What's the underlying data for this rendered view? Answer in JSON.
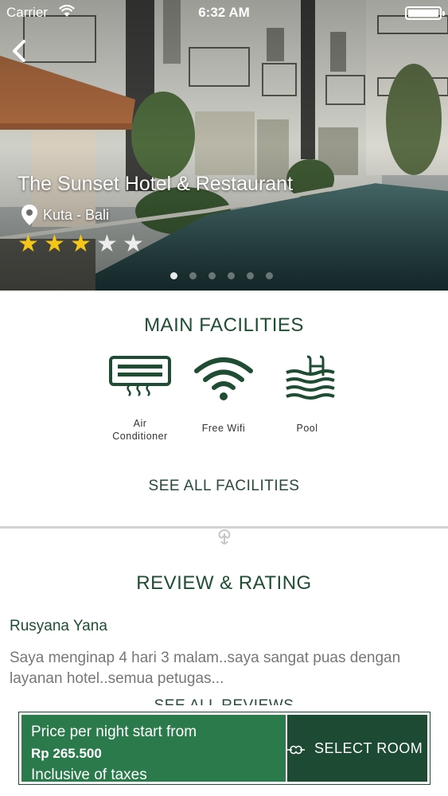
{
  "status_bar": {
    "carrier": "Carrier",
    "time": "6:32 AM",
    "battery": "full"
  },
  "hero": {
    "hotel_name": "The Sunset Hotel & Restaurant",
    "location": "Kuta - Bali",
    "rating": 3,
    "max_rating": 5,
    "carousel_pages": 6,
    "carousel_active_index": 0
  },
  "facilities": {
    "title": "MAIN FACILITIES",
    "items": [
      {
        "icon": "air-conditioner-icon",
        "label_line1": "Air",
        "label_line2": "Conditioner"
      },
      {
        "icon": "wifi-icon",
        "label_line1": "Free Wifi",
        "label_line2": ""
      },
      {
        "icon": "pool-icon",
        "label_line1": "Pool",
        "label_line2": ""
      }
    ],
    "see_all": "SEE ALL FACILITIES"
  },
  "reviews": {
    "title": "REVIEW & RATING",
    "reviewer": "Rusyana Yana",
    "text": "Saya menginap 4 hari 3 malam..saya sangat puas dengan layanan hotel..semua petugas...",
    "see_all": "SEE ALL REVIEWS"
  },
  "booking": {
    "price_line1": "Price per night start from",
    "price_amount": "Rp 265.500",
    "price_line3": "Inclusive of taxes",
    "select_label": "SELECT ROOM"
  },
  "colors": {
    "dark_green": "#1d4a32",
    "price_green": "#2b7a4c",
    "title_green": "#1f4d33",
    "star_gold": "#f5c518"
  }
}
